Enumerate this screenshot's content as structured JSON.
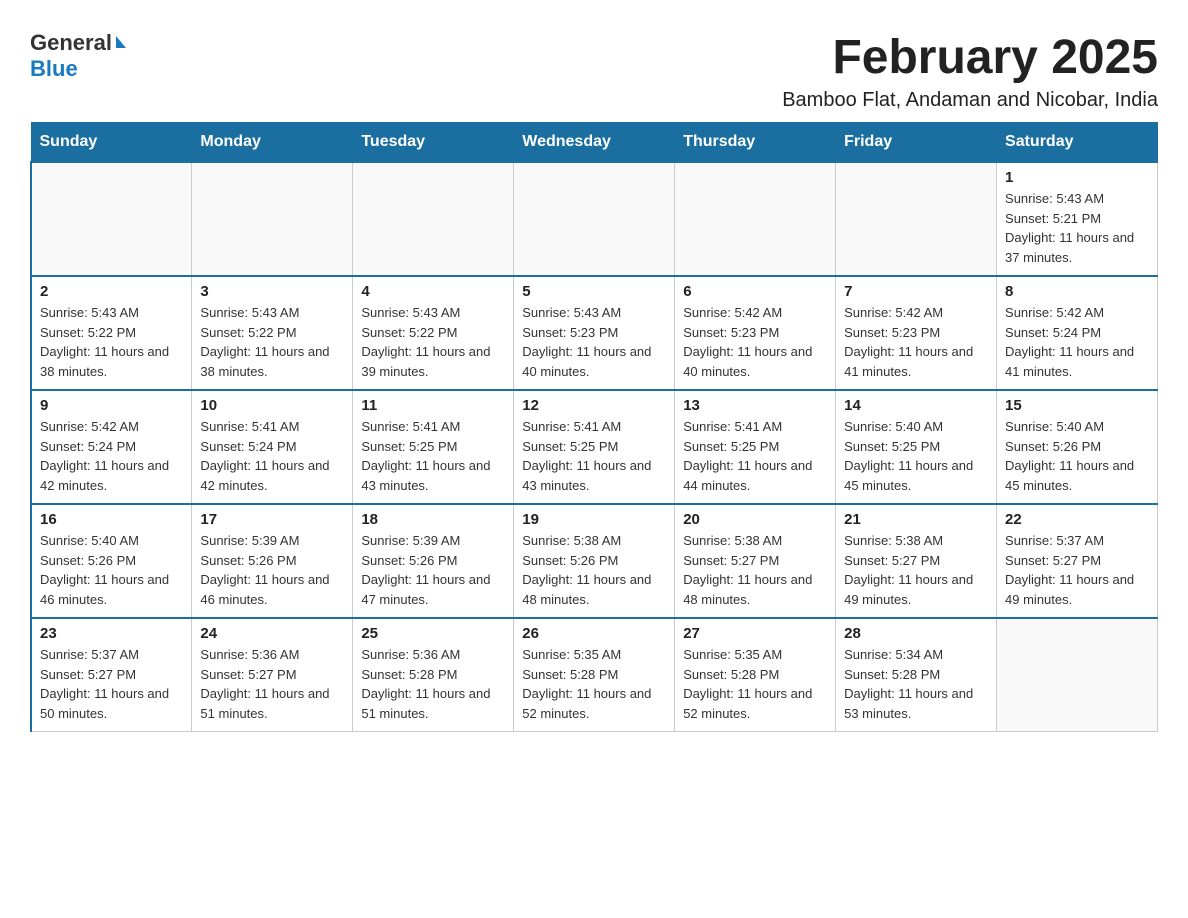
{
  "logo": {
    "general": "General",
    "blue": "Blue"
  },
  "title": "February 2025",
  "subtitle": "Bamboo Flat, Andaman and Nicobar, India",
  "header": {
    "days": [
      "Sunday",
      "Monday",
      "Tuesday",
      "Wednesday",
      "Thursday",
      "Friday",
      "Saturday"
    ]
  },
  "weeks": [
    [
      {
        "day": "",
        "info": ""
      },
      {
        "day": "",
        "info": ""
      },
      {
        "day": "",
        "info": ""
      },
      {
        "day": "",
        "info": ""
      },
      {
        "day": "",
        "info": ""
      },
      {
        "day": "",
        "info": ""
      },
      {
        "day": "1",
        "info": "Sunrise: 5:43 AM\nSunset: 5:21 PM\nDaylight: 11 hours and 37 minutes."
      }
    ],
    [
      {
        "day": "2",
        "info": "Sunrise: 5:43 AM\nSunset: 5:22 PM\nDaylight: 11 hours and 38 minutes."
      },
      {
        "day": "3",
        "info": "Sunrise: 5:43 AM\nSunset: 5:22 PM\nDaylight: 11 hours and 38 minutes."
      },
      {
        "day": "4",
        "info": "Sunrise: 5:43 AM\nSunset: 5:22 PM\nDaylight: 11 hours and 39 minutes."
      },
      {
        "day": "5",
        "info": "Sunrise: 5:43 AM\nSunset: 5:23 PM\nDaylight: 11 hours and 40 minutes."
      },
      {
        "day": "6",
        "info": "Sunrise: 5:42 AM\nSunset: 5:23 PM\nDaylight: 11 hours and 40 minutes."
      },
      {
        "day": "7",
        "info": "Sunrise: 5:42 AM\nSunset: 5:23 PM\nDaylight: 11 hours and 41 minutes."
      },
      {
        "day": "8",
        "info": "Sunrise: 5:42 AM\nSunset: 5:24 PM\nDaylight: 11 hours and 41 minutes."
      }
    ],
    [
      {
        "day": "9",
        "info": "Sunrise: 5:42 AM\nSunset: 5:24 PM\nDaylight: 11 hours and 42 minutes."
      },
      {
        "day": "10",
        "info": "Sunrise: 5:41 AM\nSunset: 5:24 PM\nDaylight: 11 hours and 42 minutes."
      },
      {
        "day": "11",
        "info": "Sunrise: 5:41 AM\nSunset: 5:25 PM\nDaylight: 11 hours and 43 minutes."
      },
      {
        "day": "12",
        "info": "Sunrise: 5:41 AM\nSunset: 5:25 PM\nDaylight: 11 hours and 43 minutes."
      },
      {
        "day": "13",
        "info": "Sunrise: 5:41 AM\nSunset: 5:25 PM\nDaylight: 11 hours and 44 minutes."
      },
      {
        "day": "14",
        "info": "Sunrise: 5:40 AM\nSunset: 5:25 PM\nDaylight: 11 hours and 45 minutes."
      },
      {
        "day": "15",
        "info": "Sunrise: 5:40 AM\nSunset: 5:26 PM\nDaylight: 11 hours and 45 minutes."
      }
    ],
    [
      {
        "day": "16",
        "info": "Sunrise: 5:40 AM\nSunset: 5:26 PM\nDaylight: 11 hours and 46 minutes."
      },
      {
        "day": "17",
        "info": "Sunrise: 5:39 AM\nSunset: 5:26 PM\nDaylight: 11 hours and 46 minutes."
      },
      {
        "day": "18",
        "info": "Sunrise: 5:39 AM\nSunset: 5:26 PM\nDaylight: 11 hours and 47 minutes."
      },
      {
        "day": "19",
        "info": "Sunrise: 5:38 AM\nSunset: 5:26 PM\nDaylight: 11 hours and 48 minutes."
      },
      {
        "day": "20",
        "info": "Sunrise: 5:38 AM\nSunset: 5:27 PM\nDaylight: 11 hours and 48 minutes."
      },
      {
        "day": "21",
        "info": "Sunrise: 5:38 AM\nSunset: 5:27 PM\nDaylight: 11 hours and 49 minutes."
      },
      {
        "day": "22",
        "info": "Sunrise: 5:37 AM\nSunset: 5:27 PM\nDaylight: 11 hours and 49 minutes."
      }
    ],
    [
      {
        "day": "23",
        "info": "Sunrise: 5:37 AM\nSunset: 5:27 PM\nDaylight: 11 hours and 50 minutes."
      },
      {
        "day": "24",
        "info": "Sunrise: 5:36 AM\nSunset: 5:27 PM\nDaylight: 11 hours and 51 minutes."
      },
      {
        "day": "25",
        "info": "Sunrise: 5:36 AM\nSunset: 5:28 PM\nDaylight: 11 hours and 51 minutes."
      },
      {
        "day": "26",
        "info": "Sunrise: 5:35 AM\nSunset: 5:28 PM\nDaylight: 11 hours and 52 minutes."
      },
      {
        "day": "27",
        "info": "Sunrise: 5:35 AM\nSunset: 5:28 PM\nDaylight: 11 hours and 52 minutes."
      },
      {
        "day": "28",
        "info": "Sunrise: 5:34 AM\nSunset: 5:28 PM\nDaylight: 11 hours and 53 minutes."
      },
      {
        "day": "",
        "info": ""
      }
    ]
  ]
}
